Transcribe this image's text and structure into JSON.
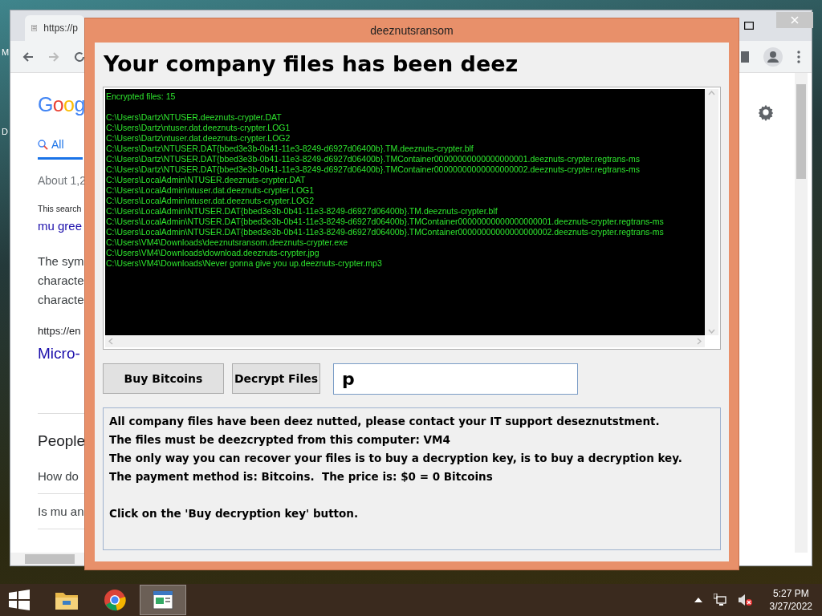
{
  "desktop_labels": [
    "M",
    "D"
  ],
  "browser": {
    "tab_url": "https://p",
    "logo": "Goog",
    "tabs": [
      {
        "label": "All",
        "selected": true
      }
    ],
    "results": [
      {
        "kind": "meta",
        "text": "About 1,2"
      },
      {
        "kind": "small",
        "text": "This search"
      },
      {
        "kind": "link",
        "text": "mu gree"
      },
      {
        "kind": "body",
        "text": "The sym"
      },
      {
        "kind": "body",
        "text": "characte"
      },
      {
        "kind": "body",
        "text": "characte"
      },
      {
        "kind": "url",
        "text": "https://en"
      },
      {
        "kind": "title",
        "text": "Micro-"
      },
      {
        "kind": "heading",
        "text": "People"
      },
      {
        "kind": "question",
        "text": "How do"
      },
      {
        "kind": "question",
        "text": "Is mu an"
      }
    ]
  },
  "ransom_window": {
    "title": "deeznutsransom",
    "heading": "Your company files has been deez",
    "log": {
      "count_line": "Encrypted files: 15",
      "paths": [
        "C:\\Users\\Dartz\\NTUSER.deeznuts-crypter.DAT",
        "C:\\Users\\Dartz\\ntuser.dat.deeznuts-crypter.LOG1",
        "C:\\Users\\Dartz\\ntuser.dat.deeznuts-crypter.LOG2",
        "C:\\Users\\Dartz\\NTUSER.DAT{bbed3e3b-0b41-11e3-8249-d6927d06400b}.TM.deeznuts-crypter.blf",
        "C:\\Users\\Dartz\\NTUSER.DAT{bbed3e3b-0b41-11e3-8249-d6927d06400b}.TMContainer00000000000000000001.deeznuts-crypter.regtrans-ms",
        "C:\\Users\\Dartz\\NTUSER.DAT{bbed3e3b-0b41-11e3-8249-d6927d06400b}.TMContainer00000000000000000002.deeznuts-crypter.regtrans-ms",
        "C:\\Users\\LocalAdmin\\NTUSER.deeznuts-crypter.DAT",
        "C:\\Users\\LocalAdmin\\ntuser.dat.deeznuts-crypter.LOG1",
        "C:\\Users\\LocalAdmin\\ntuser.dat.deeznuts-crypter.LOG2",
        "C:\\Users\\LocalAdmin\\NTUSER.DAT{bbed3e3b-0b41-11e3-8249-d6927d06400b}.TM.deeznuts-crypter.blf",
        "C:\\Users\\LocalAdmin\\NTUSER.DAT{bbed3e3b-0b41-11e3-8249-d6927d06400b}.TMContainer00000000000000000001.deeznuts-crypter.regtrans-ms",
        "C:\\Users\\LocalAdmin\\NTUSER.DAT{bbed3e3b-0b41-11e3-8249-d6927d06400b}.TMContainer00000000000000000002.deeznuts-crypter.regtrans-ms",
        "C:\\Users\\VM4\\Downloads\\deeznutsransom.deeznuts-crypter.exe",
        "C:\\Users\\VM4\\Downloads\\download.deeznuts-crypter.jpg",
        "C:\\Users\\VM4\\Downloads\\Never gonna give you up.deeznuts-crypter.mp3"
      ]
    },
    "buttons": [
      {
        "label": "Buy Bitcoins"
      },
      {
        "label": "Decrypt Files"
      }
    ],
    "key_input": {
      "value": "p"
    },
    "message_blocks": [
      {
        "lines": [
          "All company files have been deez nutted, please contact your IT support deseznutstment.",
          "The files must be deezcrypted from this computer: VM4",
          "The only way you can recover your files is to buy a decryption key, is to buy a decryption key.",
          "The payment method is: Bitcoins.  The price is: $0 = 0 Bitcoins"
        ]
      },
      {
        "lines": [
          "Click on the 'Buy decryption key' button."
        ]
      }
    ]
  },
  "taskbar": {
    "apps": [
      {
        "kind": "explorer",
        "selected": false
      },
      {
        "kind": "chrome",
        "selected": false
      },
      {
        "kind": "app",
        "selected": true
      }
    ],
    "clock": {
      "time": "5:27 PM",
      "date": "3/27/2022"
    }
  }
}
